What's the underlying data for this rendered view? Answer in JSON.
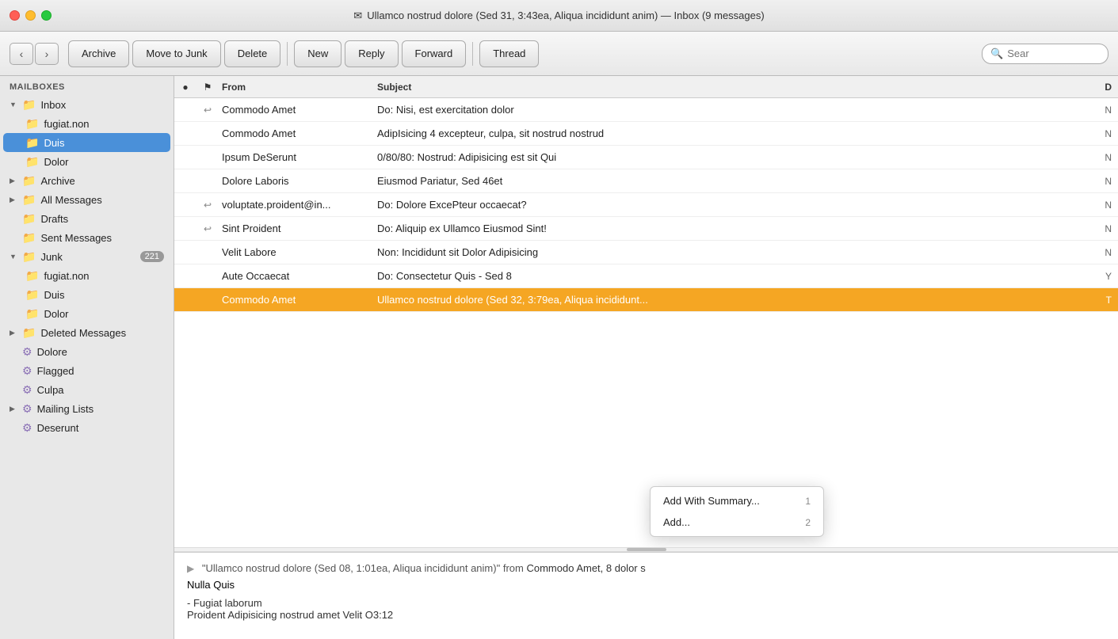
{
  "window": {
    "title": "Ullamco nostrud dolore (Sed 31, 3:43ea, Aliqua incididunt anim) — Inbox (9 messages)",
    "envelope_icon": "✉"
  },
  "toolbar": {
    "back_label": "‹",
    "forward_label": "›",
    "archive_label": "Archive",
    "move_to_junk_label": "Move to Junk",
    "delete_label": "Delete",
    "new_label": "New",
    "reply_label": "Reply",
    "forward_btn_label": "Forward",
    "thread_label": "Thread",
    "search_placeholder": "Sear"
  },
  "sidebar": {
    "section_label": "MAILBOXES",
    "items": [
      {
        "id": "inbox",
        "label": "Inbox",
        "icon": "folder",
        "indent": 0,
        "expanded": true,
        "active": false,
        "badge": ""
      },
      {
        "id": "fugiat-non-inbox",
        "label": "fugiat.non",
        "icon": "folder",
        "indent": 1,
        "active": false,
        "badge": ""
      },
      {
        "id": "duis-inbox",
        "label": "Duis",
        "icon": "folder",
        "indent": 1,
        "active": false,
        "badge": ""
      },
      {
        "id": "dolor-inbox",
        "label": "Dolor",
        "icon": "folder",
        "indent": 1,
        "active": false,
        "badge": ""
      },
      {
        "id": "archive",
        "label": "Archive",
        "icon": "folder",
        "indent": 0,
        "expanded": false,
        "active": false,
        "badge": ""
      },
      {
        "id": "all-messages",
        "label": "All Messages",
        "icon": "folder",
        "indent": 0,
        "expanded": false,
        "active": false,
        "badge": ""
      },
      {
        "id": "drafts",
        "label": "Drafts",
        "icon": "folder",
        "indent": 0,
        "active": false,
        "badge": ""
      },
      {
        "id": "sent-messages",
        "label": "Sent Messages",
        "icon": "folder",
        "indent": 0,
        "active": false,
        "badge": ""
      },
      {
        "id": "junk",
        "label": "Junk",
        "icon": "folder",
        "indent": 0,
        "expanded": true,
        "active": false,
        "badge": "221"
      },
      {
        "id": "fugiat-non-junk",
        "label": "fugiat.non",
        "icon": "folder",
        "indent": 1,
        "active": false,
        "badge": ""
      },
      {
        "id": "duis-junk",
        "label": "Duis",
        "icon": "folder",
        "indent": 1,
        "active": false,
        "badge": ""
      },
      {
        "id": "dolor-junk",
        "label": "Dolor",
        "icon": "folder",
        "indent": 1,
        "active": false,
        "badge": ""
      },
      {
        "id": "deleted-messages",
        "label": "Deleted Messages",
        "icon": "folder",
        "indent": 0,
        "expanded": false,
        "active": false,
        "badge": ""
      },
      {
        "id": "dolore",
        "label": "Dolore",
        "icon": "gear",
        "indent": 0,
        "active": false,
        "badge": ""
      },
      {
        "id": "flagged",
        "label": "Flagged",
        "icon": "gear",
        "indent": 0,
        "active": false,
        "badge": ""
      },
      {
        "id": "culpa",
        "label": "Culpa",
        "icon": "gear",
        "indent": 0,
        "active": false,
        "badge": ""
      },
      {
        "id": "mailing-lists",
        "label": "Mailing Lists",
        "icon": "gear",
        "indent": 0,
        "expanded": false,
        "active": false,
        "badge": ""
      },
      {
        "id": "deserunt",
        "label": "Deserunt",
        "icon": "gear",
        "indent": 0,
        "active": false,
        "badge": ""
      }
    ]
  },
  "message_list": {
    "columns": {
      "dot": "●",
      "flag": "⚑",
      "from": "From",
      "subject": "Subject",
      "date": "D"
    },
    "messages": [
      {
        "id": 1,
        "dot": true,
        "flag": false,
        "reply": true,
        "from": "Commodo Amet",
        "subject": "Do: Nisi, est exercitation dolor",
        "date": "N",
        "selected": false
      },
      {
        "id": 2,
        "dot": false,
        "flag": false,
        "reply": false,
        "from": "Commodo Amet",
        "subject": "AdipIsicing 4 excepteur, culpa, sit nostrud nostrud",
        "date": "N",
        "selected": false
      },
      {
        "id": 3,
        "dot": false,
        "flag": false,
        "reply": false,
        "from": "Ipsum DeSerunt",
        "subject": "0/80/80: Nostrud: Adipisicing est sit Qui",
        "date": "N",
        "selected": false
      },
      {
        "id": 4,
        "dot": false,
        "flag": false,
        "reply": false,
        "from": "Dolore Laboris",
        "subject": "Eiusmod Pariatur, Sed 46et",
        "date": "N",
        "selected": false
      },
      {
        "id": 5,
        "dot": false,
        "flag": false,
        "reply": true,
        "from": "voluptate.proident@in...",
        "subject": "Do: Dolore ExcePteur occaecat?",
        "date": "N",
        "selected": false
      },
      {
        "id": 6,
        "dot": false,
        "flag": false,
        "reply": true,
        "from": "Sint Proident",
        "subject": "Do: Aliquip ex Ullamco Eiusmod Sint!",
        "date": "N",
        "selected": false
      },
      {
        "id": 7,
        "dot": false,
        "flag": false,
        "reply": false,
        "from": "Velit Labore",
        "subject": "Non: Incididunt sit Dolor Adipisicing",
        "date": "N",
        "selected": false
      },
      {
        "id": 8,
        "dot": false,
        "flag": false,
        "reply": false,
        "from": "Aute Occaecat",
        "subject": "Do: Consectetur Quis - Sed 8",
        "date": "Y",
        "selected": false
      },
      {
        "id": 9,
        "dot": false,
        "flag": false,
        "reply": false,
        "from": "Commodo Amet",
        "subject": "Ullamco nostrud dolore (Sed 32, 3:79ea, Aliqua incididunt...",
        "date": "T",
        "selected": true
      }
    ]
  },
  "context_menu": {
    "items": [
      {
        "id": "add-with-summary",
        "label": "Add With Summary...",
        "shortcut": "1"
      },
      {
        "id": "add",
        "label": "Add...",
        "shortcut": "2"
      }
    ]
  },
  "preview": {
    "triangle": "▶",
    "quote_text": "\"Ullamco nostrud dolore (Sed 08, 1:01ea, Aliqua incididunt anim)\"",
    "from_label": "from",
    "from_name": "Commodo Amet, 8 dolor s",
    "continuation": "Nulla Quis",
    "body_line1": "- Fugiat laborum",
    "body_line2": "Proident Adipisicing nostrud amet Velit O3:12"
  },
  "colors": {
    "selected_row": "#f5a623",
    "folder_icon": "#4a90d9",
    "gear_icon": "#8a6fb5",
    "accent_blue": "#2b6bcf"
  }
}
